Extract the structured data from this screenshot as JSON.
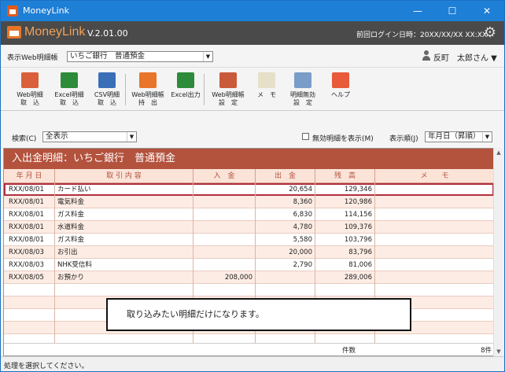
{
  "window": {
    "title": "MoneyLink",
    "min_glyph": "—",
    "max_glyph": "☐",
    "close_glyph": "✕"
  },
  "header": {
    "logo": "MoneyLink",
    "version": "V.2.01.00",
    "last_login_label": "前回ログイン日時：20XX/XX/XX XX:XX",
    "gear_glyph": "⚙"
  },
  "statement_selector": {
    "label": "表示Web明細帳",
    "value": "いちご銀行　普通預金",
    "arrow": "▼"
  },
  "user": {
    "name": "反町　太郎さん ▼"
  },
  "toolbar": [
    {
      "name": "import-web-button",
      "l1": "Web明細",
      "l2": "取　込",
      "color": "#d9603a",
      "icon": "web-statement-icon"
    },
    {
      "name": "import-excel-button",
      "l1": "Excel明細",
      "l2": "取　込",
      "color": "#2e8b3a",
      "icon": "excel-icon"
    },
    {
      "name": "import-csv-button",
      "l1": "CSV明細",
      "l2": "取　込",
      "color": "#3a6fb8",
      "icon": "csv-icon"
    },
    {
      "name": "export-web-button",
      "l1": "Web明細帳",
      "l2": "持　出",
      "color": "#e8752a",
      "icon": "export-icon"
    },
    {
      "name": "excel-output-button",
      "l1": "Excel出力",
      "l2": "",
      "color": "#2e8b3a",
      "icon": "excel-output-icon"
    },
    {
      "name": "web-settings-button",
      "l1": "Web明細帳",
      "l2": "設　定",
      "color": "#c95a3a",
      "icon": "settings-icon"
    },
    {
      "name": "memo-button",
      "l1": "メ　モ",
      "l2": "",
      "color": "#e6e0c8",
      "icon": "memo-icon"
    },
    {
      "name": "invalidate-button",
      "l1": "明細無効",
      "l2": "設　定",
      "color": "#7a9cc8",
      "icon": "invalidate-icon"
    },
    {
      "name": "help-button",
      "l1": "ヘルプ",
      "l2": "",
      "color": "#e85a3a",
      "icon": "lifebuoy-icon"
    }
  ],
  "filter": {
    "search_label": "検索(C)",
    "search_value": "全表示",
    "show_invalid_label": "無効明細を表示(M)",
    "order_label": "表示順(J)",
    "order_value": "年月日（昇順）",
    "arrow": "▼"
  },
  "panel": {
    "title": "入出金明細：いちご銀行　普通預金",
    "columns": [
      "年 月 日",
      "取 引 内 容",
      "入　金",
      "出　金",
      "残　高",
      "メ　　モ"
    ],
    "rows": [
      {
        "date": "RXX/08/01",
        "desc": "カード払い",
        "in": "",
        "out": "20,654",
        "bal": "129,346",
        "memo": ""
      },
      {
        "date": "RXX/08/01",
        "desc": "電気料金",
        "in": "",
        "out": "8,360",
        "bal": "120,986",
        "memo": ""
      },
      {
        "date": "RXX/08/01",
        "desc": "ガス料金",
        "in": "",
        "out": "6,830",
        "bal": "114,156",
        "memo": ""
      },
      {
        "date": "RXX/08/01",
        "desc": "水道料金",
        "in": "",
        "out": "4,780",
        "bal": "109,376",
        "memo": ""
      },
      {
        "date": "RXX/08/01",
        "desc": "ガス料金",
        "in": "",
        "out": "5,580",
        "bal": "103,796",
        "memo": ""
      },
      {
        "date": "RXX/08/03",
        "desc": "お引出",
        "in": "",
        "out": "20,000",
        "bal": "83,796",
        "memo": ""
      },
      {
        "date": "RXX/08/03",
        "desc": "NHK受信料",
        "in": "",
        "out": "2,790",
        "bal": "81,006",
        "memo": ""
      },
      {
        "date": "RXX/08/05",
        "desc": "お預かり",
        "in": "208,000",
        "out": "",
        "bal": "289,006",
        "memo": ""
      },
      {
        "date": "",
        "desc": "",
        "in": "",
        "out": "",
        "bal": "",
        "memo": ""
      },
      {
        "date": "",
        "desc": "",
        "in": "",
        "out": "",
        "bal": "",
        "memo": ""
      },
      {
        "date": "",
        "desc": "",
        "in": "",
        "out": "",
        "bal": "",
        "memo": ""
      },
      {
        "date": "",
        "desc": "",
        "in": "",
        "out": "",
        "bal": "",
        "memo": ""
      },
      {
        "date": "",
        "desc": "",
        "in": "",
        "out": "",
        "bal": "",
        "memo": ""
      }
    ],
    "footer_label": "件数",
    "footer_count": "8件",
    "scroll_up": "▲",
    "scroll_down": "▼"
  },
  "callout": "取り込みたい明細だけになります。",
  "status": "処理を選択してください。"
}
